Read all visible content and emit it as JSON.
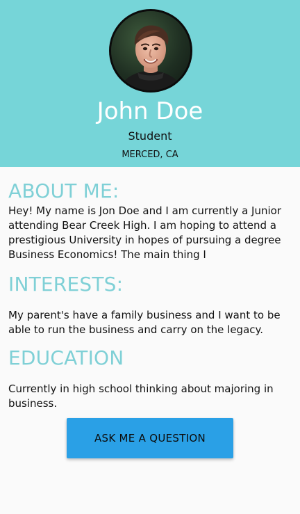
{
  "profile": {
    "name": "John Doe",
    "role": "Student",
    "location": "MERCED, CA"
  },
  "sections": {
    "about": {
      "title": "ABOUT ME:",
      "text": "Hey! My name is Jon Doe and I am currently a Junior attending Bear Creek High. I am hoping to attend a prestigious University in hopes of pursuing a degree Business Economics! The main thing I"
    },
    "interests": {
      "title": "INTERESTS:",
      "text": "My parent's have a family business and I want to be able to run the business and carry on the legacy."
    },
    "education": {
      "title": "EDUCATION",
      "text": "Currently in high school thinking about majoring in business."
    }
  },
  "actions": {
    "ask_label": "ASK ME A QUESTION"
  },
  "colors": {
    "header_bg": "#76d5d8",
    "section_title": "#7fd0d6",
    "button_bg": "#2aa0e6"
  }
}
